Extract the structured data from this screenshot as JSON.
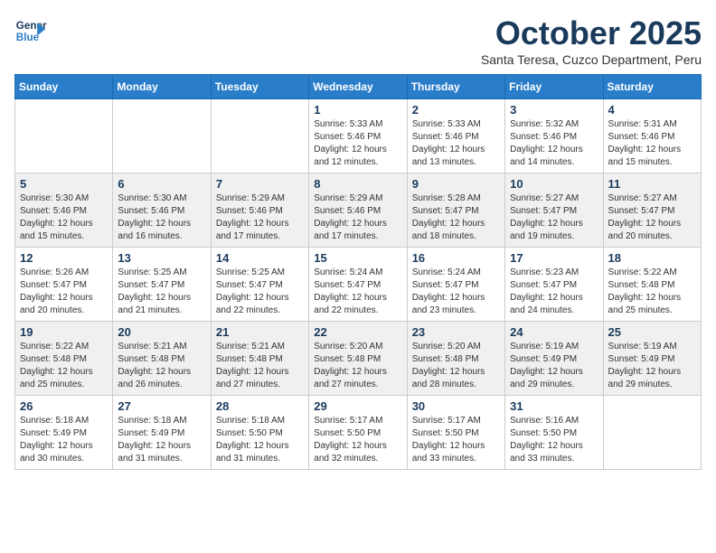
{
  "logo": {
    "line1": "General",
    "line2": "Blue"
  },
  "title": "October 2025",
  "subtitle": "Santa Teresa, Cuzco Department, Peru",
  "days_of_week": [
    "Sunday",
    "Monday",
    "Tuesday",
    "Wednesday",
    "Thursday",
    "Friday",
    "Saturday"
  ],
  "weeks": [
    [
      {
        "day": "",
        "info": ""
      },
      {
        "day": "",
        "info": ""
      },
      {
        "day": "",
        "info": ""
      },
      {
        "day": "1",
        "info": "Sunrise: 5:33 AM\nSunset: 5:46 PM\nDaylight: 12 hours and 12 minutes."
      },
      {
        "day": "2",
        "info": "Sunrise: 5:33 AM\nSunset: 5:46 PM\nDaylight: 12 hours and 13 minutes."
      },
      {
        "day": "3",
        "info": "Sunrise: 5:32 AM\nSunset: 5:46 PM\nDaylight: 12 hours and 14 minutes."
      },
      {
        "day": "4",
        "info": "Sunrise: 5:31 AM\nSunset: 5:46 PM\nDaylight: 12 hours and 15 minutes."
      }
    ],
    [
      {
        "day": "5",
        "info": "Sunrise: 5:30 AM\nSunset: 5:46 PM\nDaylight: 12 hours and 15 minutes."
      },
      {
        "day": "6",
        "info": "Sunrise: 5:30 AM\nSunset: 5:46 PM\nDaylight: 12 hours and 16 minutes."
      },
      {
        "day": "7",
        "info": "Sunrise: 5:29 AM\nSunset: 5:46 PM\nDaylight: 12 hours and 17 minutes."
      },
      {
        "day": "8",
        "info": "Sunrise: 5:29 AM\nSunset: 5:46 PM\nDaylight: 12 hours and 17 minutes."
      },
      {
        "day": "9",
        "info": "Sunrise: 5:28 AM\nSunset: 5:47 PM\nDaylight: 12 hours and 18 minutes."
      },
      {
        "day": "10",
        "info": "Sunrise: 5:27 AM\nSunset: 5:47 PM\nDaylight: 12 hours and 19 minutes."
      },
      {
        "day": "11",
        "info": "Sunrise: 5:27 AM\nSunset: 5:47 PM\nDaylight: 12 hours and 20 minutes."
      }
    ],
    [
      {
        "day": "12",
        "info": "Sunrise: 5:26 AM\nSunset: 5:47 PM\nDaylight: 12 hours and 20 minutes."
      },
      {
        "day": "13",
        "info": "Sunrise: 5:25 AM\nSunset: 5:47 PM\nDaylight: 12 hours and 21 minutes."
      },
      {
        "day": "14",
        "info": "Sunrise: 5:25 AM\nSunset: 5:47 PM\nDaylight: 12 hours and 22 minutes."
      },
      {
        "day": "15",
        "info": "Sunrise: 5:24 AM\nSunset: 5:47 PM\nDaylight: 12 hours and 22 minutes."
      },
      {
        "day": "16",
        "info": "Sunrise: 5:24 AM\nSunset: 5:47 PM\nDaylight: 12 hours and 23 minutes."
      },
      {
        "day": "17",
        "info": "Sunrise: 5:23 AM\nSunset: 5:47 PM\nDaylight: 12 hours and 24 minutes."
      },
      {
        "day": "18",
        "info": "Sunrise: 5:22 AM\nSunset: 5:48 PM\nDaylight: 12 hours and 25 minutes."
      }
    ],
    [
      {
        "day": "19",
        "info": "Sunrise: 5:22 AM\nSunset: 5:48 PM\nDaylight: 12 hours and 25 minutes."
      },
      {
        "day": "20",
        "info": "Sunrise: 5:21 AM\nSunset: 5:48 PM\nDaylight: 12 hours and 26 minutes."
      },
      {
        "day": "21",
        "info": "Sunrise: 5:21 AM\nSunset: 5:48 PM\nDaylight: 12 hours and 27 minutes."
      },
      {
        "day": "22",
        "info": "Sunrise: 5:20 AM\nSunset: 5:48 PM\nDaylight: 12 hours and 27 minutes."
      },
      {
        "day": "23",
        "info": "Sunrise: 5:20 AM\nSunset: 5:48 PM\nDaylight: 12 hours and 28 minutes."
      },
      {
        "day": "24",
        "info": "Sunrise: 5:19 AM\nSunset: 5:49 PM\nDaylight: 12 hours and 29 minutes."
      },
      {
        "day": "25",
        "info": "Sunrise: 5:19 AM\nSunset: 5:49 PM\nDaylight: 12 hours and 29 minutes."
      }
    ],
    [
      {
        "day": "26",
        "info": "Sunrise: 5:18 AM\nSunset: 5:49 PM\nDaylight: 12 hours and 30 minutes."
      },
      {
        "day": "27",
        "info": "Sunrise: 5:18 AM\nSunset: 5:49 PM\nDaylight: 12 hours and 31 minutes."
      },
      {
        "day": "28",
        "info": "Sunrise: 5:18 AM\nSunset: 5:50 PM\nDaylight: 12 hours and 31 minutes."
      },
      {
        "day": "29",
        "info": "Sunrise: 5:17 AM\nSunset: 5:50 PM\nDaylight: 12 hours and 32 minutes."
      },
      {
        "day": "30",
        "info": "Sunrise: 5:17 AM\nSunset: 5:50 PM\nDaylight: 12 hours and 33 minutes."
      },
      {
        "day": "31",
        "info": "Sunrise: 5:16 AM\nSunset: 5:50 PM\nDaylight: 12 hours and 33 minutes."
      },
      {
        "day": "",
        "info": ""
      }
    ]
  ]
}
